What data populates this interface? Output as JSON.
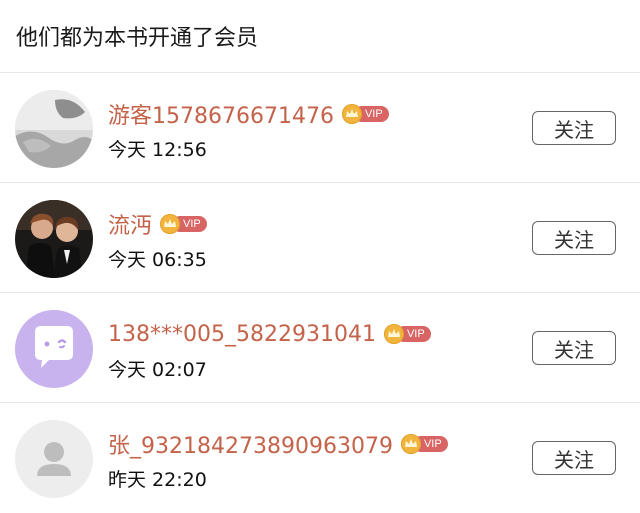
{
  "header": {
    "title": "他们都为本书开通了会员"
  },
  "members": [
    {
      "name": "游客1578676671476",
      "badge": "VIP",
      "time": "今天 12:56",
      "follow_label": "关注",
      "avatar": "photo-face"
    },
    {
      "name": "流沔",
      "badge": "VIP",
      "time": "今天 06:35",
      "follow_label": "关注",
      "avatar": "photo-two-people"
    },
    {
      "name": "138***005_5822931041",
      "badge": "VIP",
      "time": "今天 02:07",
      "follow_label": "关注",
      "avatar": "chat-bubble-icon"
    },
    {
      "name": "张_932184273890963079",
      "badge": "VIP",
      "time": "昨天 22:20",
      "follow_label": "关注",
      "avatar": "default-user-icon"
    }
  ],
  "colors": {
    "name": "#c4634a",
    "vip_tag": "#d86464",
    "vip_crown": "#f1b43d",
    "divider": "#e8e8e8"
  }
}
